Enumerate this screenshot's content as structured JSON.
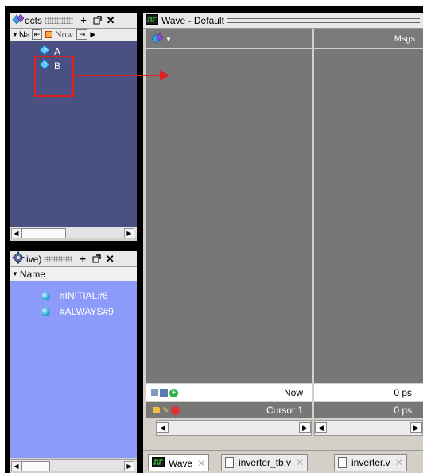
{
  "objects": {
    "title": "ects",
    "toolbar_label": "Na",
    "now_label": "Now",
    "signals": [
      {
        "name": "A"
      },
      {
        "name": "B"
      }
    ]
  },
  "processes": {
    "title": "ive)",
    "column": "Name",
    "items": [
      {
        "name": "#INITIAL#6"
      },
      {
        "name": "#ALWAYS#9"
      }
    ]
  },
  "wave": {
    "title": "Wave - Default",
    "msgs_header": "Msgs",
    "now": {
      "label": "Now",
      "value": "0 ps"
    },
    "cursor": {
      "label": "Cursor 1",
      "value": "0 ps"
    }
  },
  "tabs": [
    {
      "label": "Wave",
      "close": "✕",
      "active": true
    },
    {
      "label": "inverter_tb.v",
      "close": "✕",
      "active": false
    },
    {
      "label": "inverter.v",
      "close": "✕",
      "active": false
    }
  ],
  "colors": {
    "objects_bg": "#4a5082",
    "processes_bg": "#8c9bfa",
    "wave_bg": "#777777",
    "annotation": "#e02020"
  }
}
